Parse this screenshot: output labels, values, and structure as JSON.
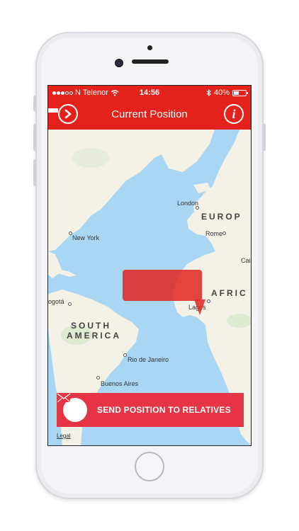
{
  "status_bar": {
    "carrier": "N Telenor",
    "time": "14:56",
    "battery": "40%",
    "battery_level": 0.4
  },
  "nav": {
    "title": "Current Position",
    "info_label": "i"
  },
  "map": {
    "labels": {
      "london": "London",
      "europe": "EUROP",
      "rome": "Rome",
      "cairo": "Cai",
      "new_york": "New York",
      "africa": "AFRIC",
      "lagos": "Lagos",
      "bogota": "ogotá",
      "south": "SOUTH",
      "america": "AMERICA",
      "rio": "Rio de Janeiro",
      "buenos_aires": "Buenos Aires"
    },
    "legal": "Legal"
  },
  "send_button": {
    "label": "SEND POSITION TO RELATIVES"
  },
  "colors": {
    "brand_red": "#e4221b",
    "button_red": "#e53545",
    "water": "#a9d6f2",
    "land": "#f4f1e6"
  }
}
